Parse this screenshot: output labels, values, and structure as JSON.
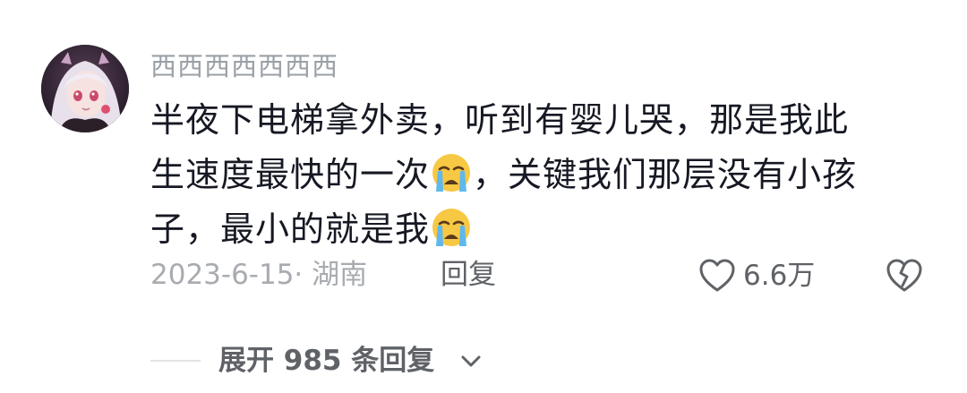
{
  "comment": {
    "username": "西西西西西西西",
    "body_lines": [
      {
        "before": "半夜下电梯拿外卖，听到有婴儿哭，那是我此",
        "emoji": null,
        "after": ""
      },
      {
        "before": "生速度最快的一次",
        "emoji": "loudly-crying-face",
        "after": "，关键我们那层没有小孩"
      },
      {
        "before": "子，最小的就是我",
        "emoji": "loudly-crying-face",
        "after": ""
      }
    ],
    "date_location": "2023-6-15· 湖南",
    "reply_label": "回复",
    "like_count": "6.6万",
    "like_icon": "heart-outline-icon",
    "dislike_icon": "broken-heart-icon",
    "expand_label": "展开 985 条回复",
    "expand_icon": "chevron-down-icon"
  },
  "colors": {
    "text_primary": "#161823",
    "text_secondary": "#9aa0a6",
    "action": "#5f6266",
    "background": "#ffffff"
  }
}
